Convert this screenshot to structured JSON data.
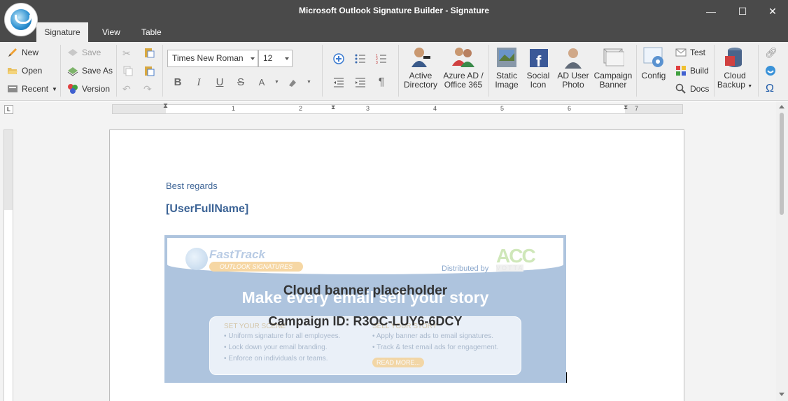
{
  "window": {
    "title": "Microsoft Outlook Signature Builder - Signature",
    "minimize": "—",
    "maximize": "☐",
    "close": "✕"
  },
  "tabs": [
    "Signature",
    "View",
    "Table"
  ],
  "ribbon": {
    "file": {
      "new": "New",
      "open": "Open",
      "recent": "Recent",
      "save": "Save",
      "save_as": "Save As",
      "version": "Version"
    },
    "font": {
      "family": "Times New Roman",
      "size": "12"
    },
    "big_buttons": {
      "active_directory": [
        "Active",
        "Directory"
      ],
      "azure_ad": [
        "Azure AD /",
        "Office 365"
      ],
      "static_image": [
        "Static",
        "Image"
      ],
      "social_icon": [
        "Social",
        "Icon"
      ],
      "ad_user_photo": [
        "AD User",
        "Photo"
      ],
      "campaign_banner": [
        "Campaign",
        "Banner"
      ],
      "config": [
        "Config"
      ],
      "cloud_backup": [
        "Cloud",
        "Backup"
      ]
    },
    "tools": {
      "test": "Test",
      "build": "Build",
      "docs": "Docs"
    },
    "format_glyphs": {
      "bold": "B",
      "italic": "I",
      "underline": "U",
      "strike": "S",
      "font_color": "A",
      "paragraph": "¶",
      "omega": "Ω"
    }
  },
  "ruler": {
    "corner": "L",
    "numbers": [
      "1",
      "2",
      "3",
      "4",
      "5",
      "6",
      "7"
    ]
  },
  "document": {
    "regards": "Best regards",
    "username": "[UserFullName]",
    "banner": {
      "brand": "FastTrack",
      "brand_sub": "OUTLOOK SIGNATURES",
      "distributed_by": "Distributed by",
      "partner": "ACC",
      "partner_sub": "VOTTA",
      "tagline": "Make every email sell your story",
      "left_heading": "SET YOUR SCENE",
      "left_items": [
        "• Uniform signature for all employees.",
        "• Lock down your email branding.",
        "• Enforce on individuals or teams."
      ],
      "right_heading": "SELL YOUR STORY",
      "right_items": [
        "• Apply banner ads to email signatures.",
        "• Track & test email ads for engagement."
      ],
      "read_more": "READ MORE...",
      "placeholder_title": "Cloud banner placeholder",
      "campaign_id": "Campaign ID: R3OC-LUY6-6DCY"
    }
  }
}
